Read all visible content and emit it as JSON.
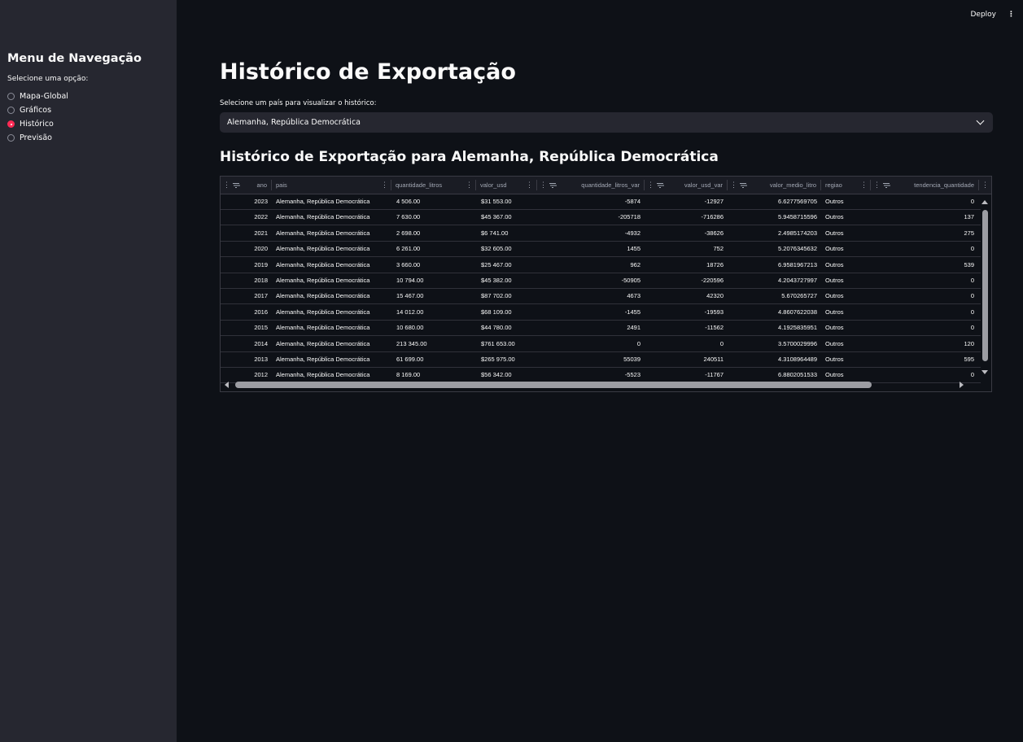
{
  "sidebar": {
    "title": "Menu de Navegação",
    "label": "Selecione uma opção:",
    "options": [
      {
        "label": "Mapa-Global",
        "selected": false
      },
      {
        "label": "Gráficos",
        "selected": false
      },
      {
        "label": "Histórico",
        "selected": true
      },
      {
        "label": "Previsão",
        "selected": false
      }
    ]
  },
  "topbar": {
    "deploy": "Deploy",
    "menu": "⋮"
  },
  "main": {
    "title": "Histórico de Exportação",
    "select_label": "Selecione um país para visualizar o histórico:",
    "select_value": "Alemanha, República Democrática",
    "subtitle": "Histórico de Exportação para Alemanha, República Democrática"
  },
  "table": {
    "columns": [
      "ano",
      "pais",
      "quantidade_litros",
      "valor_usd",
      "quantidade_litros_var",
      "valor_usd_var",
      "valor_medio_litro",
      "regiao",
      "tendencia_quantidade"
    ],
    "rows": [
      [
        "2023",
        "Alemanha, República Democrática",
        "4 506.00",
        "$31 553.00",
        "-5874",
        "-12927",
        "6.6277569705",
        "Outros",
        "0"
      ],
      [
        "2022",
        "Alemanha, República Democrática",
        "7 630.00",
        "$45 367.00",
        "-205718",
        "-716286",
        "5.9458715596",
        "Outros",
        "137"
      ],
      [
        "2021",
        "Alemanha, República Democrática",
        "2 698.00",
        "$6 741.00",
        "-4932",
        "-38626",
        "2.4985174203",
        "Outros",
        "275"
      ],
      [
        "2020",
        "Alemanha, República Democrática",
        "6 261.00",
        "$32 605.00",
        "1455",
        "752",
        "5.2076345632",
        "Outros",
        "0"
      ],
      [
        "2019",
        "Alemanha, República Democrática",
        "3 660.00",
        "$25 467.00",
        "962",
        "18726",
        "6.9581967213",
        "Outros",
        "539"
      ],
      [
        "2018",
        "Alemanha, República Democrática",
        "10 794.00",
        "$45 382.00",
        "-50905",
        "-220596",
        "4.2043727997",
        "Outros",
        "0"
      ],
      [
        "2017",
        "Alemanha, República Democrática",
        "15 467.00",
        "$87 702.00",
        "4673",
        "42320",
        "5.670265727",
        "Outros",
        "0"
      ],
      [
        "2016",
        "Alemanha, República Democrática",
        "14 012.00",
        "$68 109.00",
        "-1455",
        "-19593",
        "4.8607622038",
        "Outros",
        "0"
      ],
      [
        "2015",
        "Alemanha, República Democrática",
        "10 680.00",
        "$44 780.00",
        "2491",
        "-11562",
        "4.1925835951",
        "Outros",
        "0"
      ],
      [
        "2014",
        "Alemanha, República Democrática",
        "213 345.00",
        "$761 653.00",
        "0",
        "0",
        "3.5700029996",
        "Outros",
        "120"
      ],
      [
        "2013",
        "Alemanha, República Democrática",
        "61 699.00",
        "$265 975.00",
        "55039",
        "240511",
        "4.3108964489",
        "Outros",
        "595"
      ],
      [
        "2012",
        "Alemanha, República Democrática",
        "8 169.00",
        "$56 342.00",
        "-5523",
        "-11767",
        "6.8802051533",
        "Outros",
        "0"
      ]
    ]
  },
  "colors": {
    "accent": "#ff2b55",
    "background": "#0e1117",
    "sidebar": "#262730"
  }
}
